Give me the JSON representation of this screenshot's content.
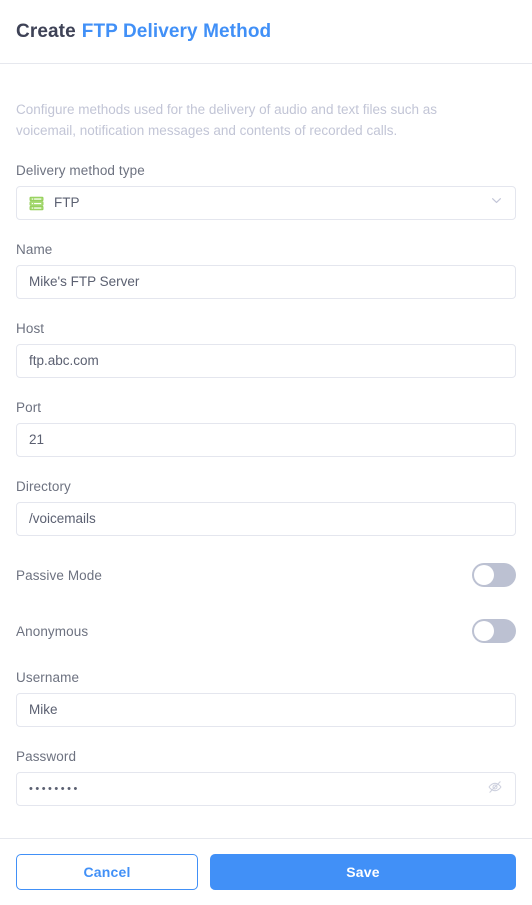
{
  "header": {
    "title_prefix": "Create",
    "title_object": "FTP Delivery Method"
  },
  "description": "Configure methods used for the delivery of audio and text files such as voicemail, notification messages and contents of recorded calls.",
  "form": {
    "delivery_method_type": {
      "label": "Delivery method type",
      "value": "FTP",
      "icon": "server-icon",
      "chevron": "chevron-down-icon"
    },
    "name": {
      "label": "Name",
      "value": "Mike's FTP Server"
    },
    "host": {
      "label": "Host",
      "value": "ftp.abc.com"
    },
    "port": {
      "label": "Port",
      "value": "21"
    },
    "directory": {
      "label": "Directory",
      "value": "/voicemails"
    },
    "passive_mode": {
      "label": "Passive Mode",
      "checked": false
    },
    "anonymous": {
      "label": "Anonymous",
      "checked": false
    },
    "username": {
      "label": "Username",
      "value": "Mike"
    },
    "password": {
      "label": "Password",
      "value": "••••••••",
      "masked": true,
      "reveal_icon": "eye-off-icon"
    }
  },
  "footer": {
    "cancel_label": "Cancel",
    "save_label": "Save"
  },
  "colors": {
    "accent": "#4190f7",
    "label": "#6d7280",
    "value_text": "#5b6071",
    "muted": "#c2c5d6",
    "border": "#e4e6ee",
    "switch_off": "#bcc1d2",
    "icon_green": "#96d35f"
  }
}
